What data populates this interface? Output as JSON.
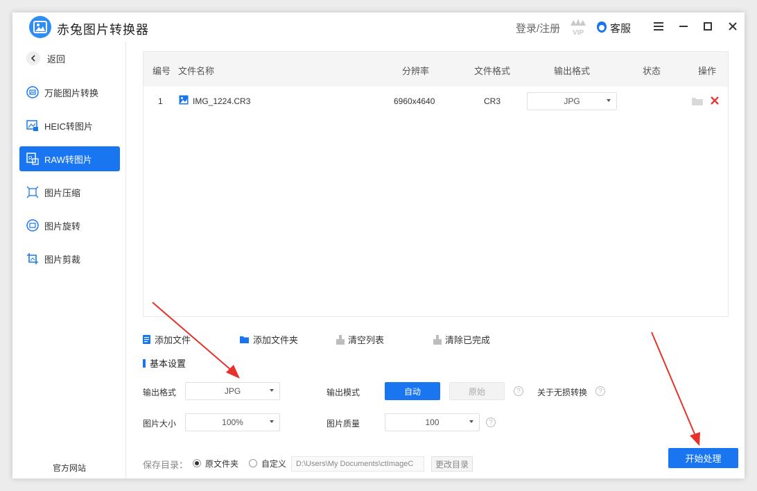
{
  "app": {
    "title": "赤兔图片转换器"
  },
  "header": {
    "login_label": "登录/注册",
    "vip_label": "VIP",
    "service_label": "客服"
  },
  "sidebar": {
    "back_label": "返回",
    "items": [
      {
        "label": "万能图片转换",
        "icon": "universal-convert-icon",
        "active": false
      },
      {
        "label": "HEIC转图片",
        "icon": "heic-icon",
        "active": false
      },
      {
        "label": "RAW转图片",
        "icon": "raw-icon",
        "active": true
      },
      {
        "label": "图片压缩",
        "icon": "compress-icon",
        "active": false
      },
      {
        "label": "图片旋转",
        "icon": "rotate-icon",
        "active": false
      },
      {
        "label": "图片剪裁",
        "icon": "crop-icon",
        "active": false
      }
    ],
    "official_site_label": "官方网站"
  },
  "table": {
    "columns": [
      "编号",
      "文件名称",
      "分辨率",
      "文件格式",
      "输出格式",
      "状态",
      "操作"
    ],
    "rows": [
      {
        "index": "1",
        "filename": "IMG_1224.CR3",
        "resolution": "6960x4640",
        "format": "CR3",
        "output_format": "JPG",
        "status": ""
      }
    ]
  },
  "actions": {
    "add_file": "添加文件",
    "add_folder": "添加文件夹",
    "clear_list": "清空列表",
    "clear_done": "清除已完成"
  },
  "settings": {
    "title": "基本设置",
    "output_format_label": "输出格式",
    "output_format_value": "JPG",
    "output_mode_label": "输出模式",
    "mode_auto": "自动",
    "mode_original": "原始",
    "lossless_label": "关于无损转换",
    "image_size_label": "图片大小",
    "image_size_value": "100%",
    "quality_label": "图片质量",
    "quality_value": "100",
    "help_glyph": "?"
  },
  "save": {
    "label": "保存目录：",
    "option_original": "原文件夹",
    "option_custom": "自定义",
    "path": "D:\\Users\\My Documents\\ctImageC",
    "change_label": "更改目录",
    "selected": "原文件夹"
  },
  "start_button": "开始处理",
  "colors": {
    "accent": "#1976f0",
    "delete": "#e53935",
    "annotation_arrow": "#e8312a"
  }
}
